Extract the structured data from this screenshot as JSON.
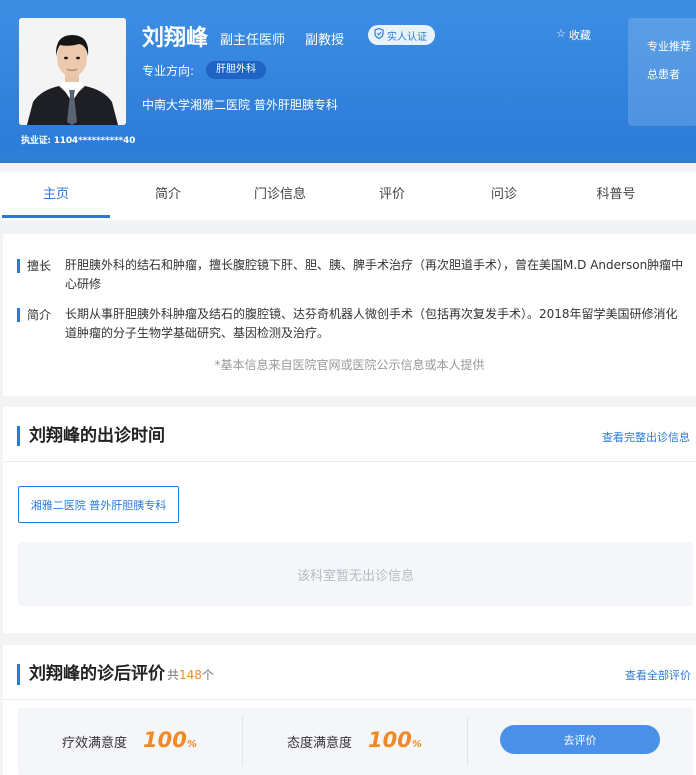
{
  "doctor": {
    "name": "刘翔峰",
    "title": "副主任医师",
    "academic_title": "副教授",
    "verified_label": "实人认证",
    "favorite_label": "收藏",
    "specialty_label": "专业方向:",
    "specialty_tag": "肝胆外科",
    "hospital": "中南大学湘雅二医院   普外肝胆胰专科",
    "license": "执业证:  1104**********40"
  },
  "side_panel": {
    "line1": "专业推荐",
    "line2": "总患者"
  },
  "tabs": [
    "主页",
    "简介",
    "门诊信息",
    "评价",
    "问诊",
    "科普号"
  ],
  "active_tab": 0,
  "info": {
    "specialty_key": "擅长",
    "specialty_text": "肝胆胰外科的结石和肿瘤，擅长腹腔镜下肝、胆、胰、脾手术治疗（再次胆道手术），曾在美国M.D Anderson肿瘤中心研修",
    "intro_key": "简介",
    "intro_text": "长期从事肝胆胰外科肿瘤及结石的腹腔镜、达芬奇机器人微创手术（包括再次复发手术）。2018年留学美国研修消化道肿瘤的分子生物学基础研究、基因检测及治疗。",
    "source_note": "*基本信息来自医院官网或医院公示信息或本人提供"
  },
  "schedule": {
    "title": "刘翔峰的出诊时间",
    "link": "查看完整出诊信息",
    "dept_button": "湘雅二医院 普外肝胆胰专科",
    "empty_text": "该科室暂无出诊信息"
  },
  "reviews": {
    "title": "刘翔峰的诊后评价",
    "count_prefix": "共",
    "count": "148",
    "count_suffix": "个",
    "link": "查看全部评价",
    "efficacy_label": "疗效满意度",
    "efficacy_value": "100",
    "attitude_label": "态度满意度",
    "attitude_value": "100",
    "percent": "%",
    "eval_button": "去评价"
  },
  "colors": {
    "primary": "#2a7ad8",
    "header": "#3d8ee3",
    "accent_orange": "#f08a24"
  }
}
